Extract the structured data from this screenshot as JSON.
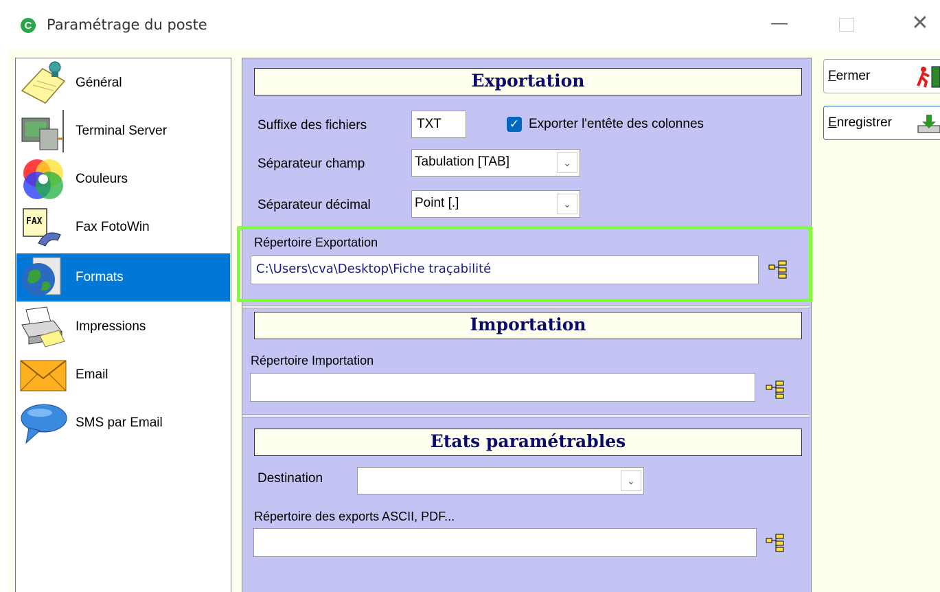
{
  "window": {
    "title": "Paramétrage du poste",
    "app_icon_glyph": "C",
    "minimize_glyph": "—",
    "close_glyph": "✕"
  },
  "sidebar": {
    "selected_index": 4,
    "items": [
      {
        "label": "Général",
        "icon": "notes-pin-icon"
      },
      {
        "label": "Terminal Server",
        "icon": "computer-network-icon"
      },
      {
        "label": "Couleurs",
        "icon": "color-circles-icon"
      },
      {
        "label": "Fax FotoWin",
        "icon": "fax-phone-icon"
      },
      {
        "label": "Formats",
        "icon": "globe-document-icon"
      },
      {
        "label": "Impressions",
        "icon": "printer-icon"
      },
      {
        "label": "Email",
        "icon": "envelope-icon"
      },
      {
        "label": "SMS par Email",
        "icon": "speech-bubble-icon"
      }
    ]
  },
  "export": {
    "title": "Exportation",
    "suffix_label": "Suffixe des fichiers",
    "suffix_value": "TXT",
    "header_checkbox_label": "Exporter l'entête des colonnes",
    "header_checkbox_checked": true,
    "field_sep_label": "Séparateur champ",
    "field_sep_value": "Tabulation [TAB]",
    "decimal_sep_label": "Séparateur décimal",
    "decimal_sep_value": "Point [.]",
    "dir_label": "Répertoire Exportation",
    "dir_value": "C:\\Users\\cva\\Desktop\\Fiche traçabilité"
  },
  "import": {
    "title": "Importation",
    "dir_label": "Répertoire Importation",
    "dir_value": ""
  },
  "reports": {
    "title": "Etats paramétrables",
    "destination_label": "Destination",
    "destination_value": "",
    "exports_dir_label": "Répertoire des exports ASCII, PDF...",
    "exports_dir_value": ""
  },
  "actions": {
    "close_label_first": "F",
    "close_label_rest": "ermer",
    "save_label_first": "E",
    "save_label_rest": "nregistrer"
  },
  "colors": {
    "panel_bg": "#c4c4f4",
    "selection": "#0078d7",
    "highlight": "#7fff3a",
    "section_title": "#0b0b6a"
  }
}
